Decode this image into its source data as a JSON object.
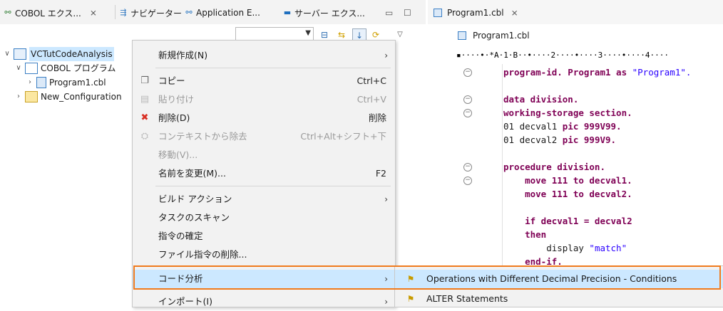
{
  "left_tabs": [
    {
      "label": "COBOL エクス...",
      "close": "⨯",
      "icon": "cobol-explorer-icon"
    },
    {
      "label": "ナビゲーター",
      "icon": "navigator-icon"
    },
    {
      "label": "Application E...",
      "icon": "application-explorer-icon"
    },
    {
      "label": "サーバー エクス...",
      "icon": "server-explorer-icon"
    }
  ],
  "right_tab": {
    "label": "Program1.cbl",
    "close": "⨯"
  },
  "editor_header": "Program1.cbl",
  "ruler": "▪····•·*A·1·B··•····2····•····3····•····4····",
  "tree": [
    {
      "label": "VCTutCodeAnalysis",
      "selected": true
    },
    {
      "label": "COBOL プログラム"
    },
    {
      "label": "Program1.cbl"
    },
    {
      "label": "New_Configuration"
    }
  ],
  "context_menu": {
    "items": [
      {
        "label": "新規作成(N)",
        "shortcut": "",
        "submenu": true
      },
      {
        "label": "コピー",
        "shortcut": "Ctrl+C"
      },
      {
        "label": "貼り付け",
        "shortcut": "Ctrl+V",
        "disabled": true
      },
      {
        "label": "削除(D)",
        "shortcut": "削除"
      },
      {
        "label": "コンテキストから除去",
        "shortcut": "Ctrl+Alt+シフト+下",
        "disabled": true
      },
      {
        "label": "移動(V)...",
        "disabled": true
      },
      {
        "label": "名前を変更(M)...",
        "shortcut": "F2"
      },
      {
        "label": "ビルド アクション",
        "submenu": true
      },
      {
        "label": "タスクのスキャン"
      },
      {
        "label": "指令の確定"
      },
      {
        "label": "ファイル指令の削除..."
      },
      {
        "label": "コード分析",
        "submenu": true,
        "highlighted": true
      },
      {
        "label": "インポート(I)",
        "submenu": true
      }
    ]
  },
  "submenu": {
    "items": [
      {
        "label": "Operations with Different Decimal Precision - Conditions",
        "highlighted": true
      },
      {
        "label": "ALTER Statements"
      }
    ]
  },
  "code_lines": [
    [
      "",
      "program-id. Program1 as ",
      "\"Program1\"."
    ],
    [
      "",
      "",
      ""
    ],
    [
      "kw",
      "data division.",
      ""
    ],
    [
      "kw",
      "working-storage section.",
      ""
    ],
    [
      "mixed1",
      "01 decval1 ",
      "pic 999V99."
    ],
    [
      "mixed1",
      "01 decval2 ",
      "pic 999V9."
    ],
    [
      "",
      "",
      ""
    ],
    [
      "kw",
      "procedure division.",
      ""
    ],
    [
      "",
      "    move 111 to decval1.",
      ""
    ],
    [
      "",
      "    move 111 to decval2.",
      ""
    ],
    [
      "",
      "",
      ""
    ],
    [
      "",
      "    if decval1 = decval2",
      ""
    ],
    [
      "kw",
      "    then",
      ""
    ],
    [
      "str",
      "        display ",
      "\"match\""
    ],
    [
      "",
      "    end-if.",
      ""
    ]
  ],
  "colors": {
    "highlight": "#f07b1d",
    "selection": "#cce8ff",
    "keyword": "#7f0055",
    "string": "#2a00ff"
  }
}
